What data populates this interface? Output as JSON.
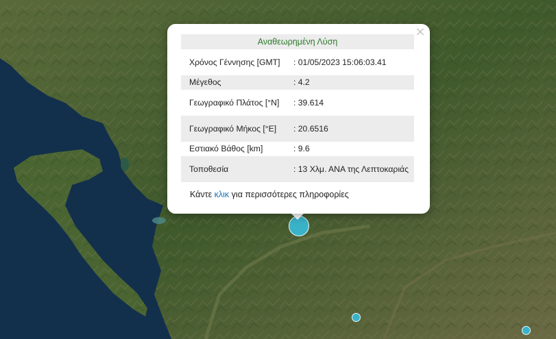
{
  "popup": {
    "title": "Αναθεωρημένη Λύση",
    "close_glyph": "×",
    "rows": [
      {
        "label": "Χρόνος Γέννησης [GMT]",
        "value": ": 01/05/2023 15:06:03.41"
      },
      {
        "label": "Μέγεθος",
        "value": ": 4.2"
      },
      {
        "label": "Γεωγραφικό Πλάτος [°N]",
        "value": ": 39.614"
      },
      {
        "label": "Γεωγραφικό Μήκος [°E]",
        "value": ": 20.6516"
      },
      {
        "label": "Εστιακό Βάθος [km]",
        "value": ": 9.6"
      },
      {
        "label": "Τοποθεσία",
        "value": ": 13 Χλμ. ΑΝΑ της Λεπτοκαριάς"
      }
    ],
    "more_prefix": "Κάντε ",
    "more_link": "κλικ",
    "more_suffix": " για περισσότερες πληροφορίες"
  },
  "map": {
    "sea_color": "#12304c",
    "land_color": "#3e5a2c",
    "marker_color": "#3ab3c9",
    "markers": [
      {
        "type": "main-epicenter",
        "selected": true
      },
      {
        "type": "epicenter"
      },
      {
        "type": "epicenter"
      }
    ]
  }
}
